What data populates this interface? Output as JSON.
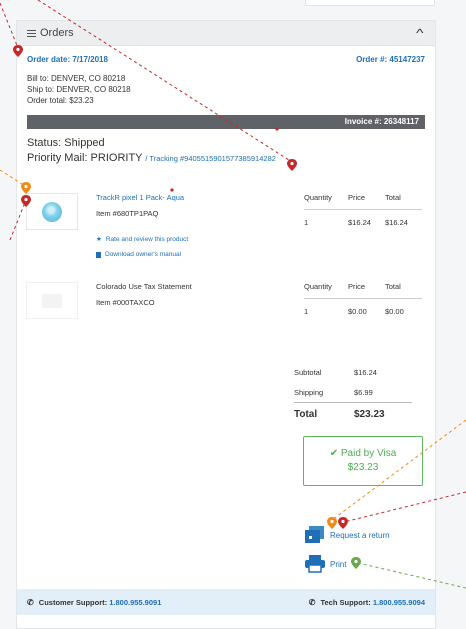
{
  "panel": {
    "title": "Orders",
    "collapse_icon": "chevron-up-icon"
  },
  "order": {
    "date_label": "Order date: 7/17/2018",
    "number_label": "Order #: 45147237",
    "bill_to": "Bill to: DENVER, CO 80218",
    "ship_to": "Ship to: DENVER, CO 80218",
    "order_total": "Order total: $23.23",
    "invoice_label": "Invoice #: 26348117",
    "status": "Status: Shipped",
    "carrier": "Priority Mail: PRIORITY",
    "tracking": "/ Tracking #9405515901577385914282"
  },
  "columns": {
    "quantity": "Quantity",
    "price": "Price",
    "total": "Total"
  },
  "items": [
    {
      "name": "TrackR pixel 1 Pack- Aqua",
      "sku": "Item #680TP1PAQ",
      "quantity": "1",
      "price": "$16.24",
      "total": "$16.24",
      "review_link": "Rate and review this product",
      "manual_link": "Download owner's manual"
    },
    {
      "name": "Colorado Use Tax Statement",
      "sku": "Item #000TAXCO",
      "quantity": "1",
      "price": "$0.00",
      "total": "$0.00"
    }
  ],
  "totals": {
    "subtotal_label": "Subtotal",
    "subtotal": "$16.24",
    "shipping_label": "Shipping",
    "shipping": "$6.99",
    "total_label": "Total",
    "total": "$23.23"
  },
  "payment": {
    "paid_label": "Paid by Visa",
    "amount": "$23.23"
  },
  "actions": {
    "return_label": "Request a return",
    "print_label": "Print"
  },
  "support": {
    "customer_label": "Customer Support:",
    "customer_number": "1.800.955.9091",
    "tech_label": "Tech Support:",
    "tech_number": "1.800.955.9094"
  },
  "colors": {
    "link": "#1f6fb8",
    "invoice_bar": "#5f6266",
    "paid_border": "#5cb85c",
    "support_bar": "#e3eff8",
    "marker_red": "#c62828",
    "marker_orange": "#ef8a17",
    "marker_green": "#6aa84f"
  }
}
